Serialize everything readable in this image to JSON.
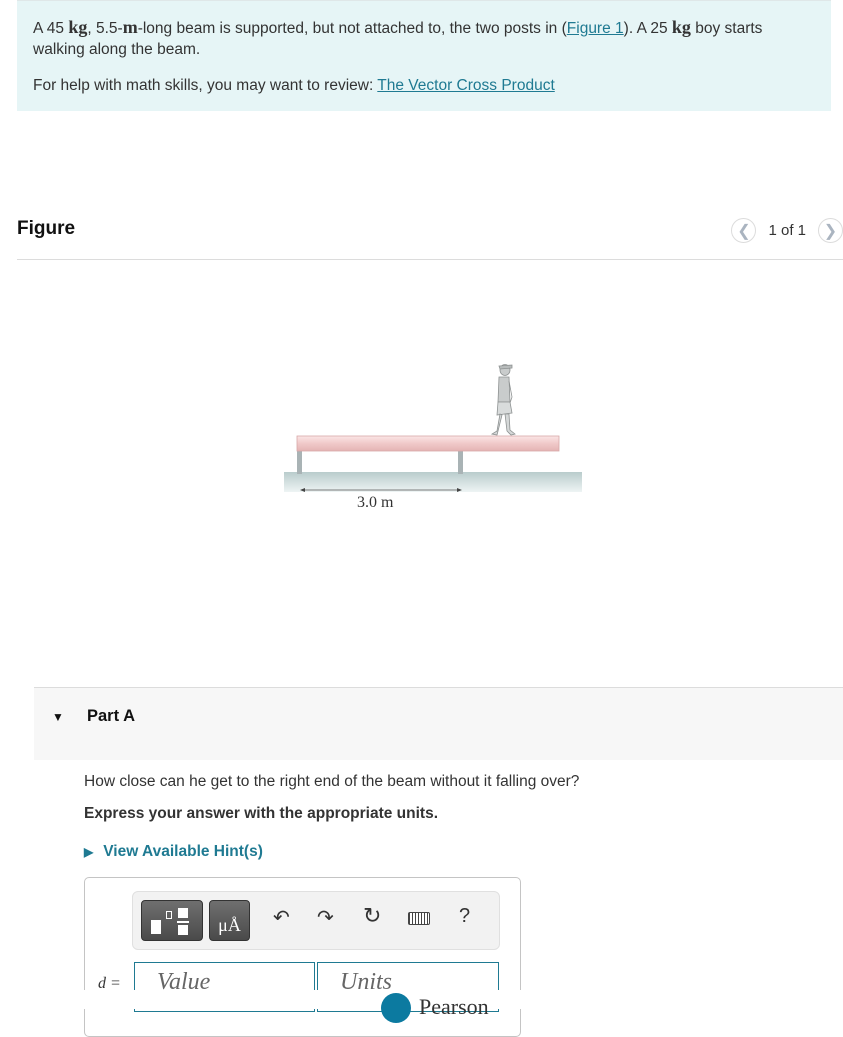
{
  "problem": {
    "text_pre1": "A 45 ",
    "unit_kg": "kg",
    "text_mid1": ", 5.5-",
    "unit_m": "m",
    "text_mid2": "-long beam is supported, but not attached to, the two posts in (",
    "figure_link": "Figure 1",
    "text_mid3": "). A 25 ",
    "unit_kg2": "kg",
    "text_post": " boy starts walking along the beam.",
    "help_text": "For help with math skills, you may want to review: ",
    "help_link": "The Vector Cross Product"
  },
  "figure": {
    "title": "Figure",
    "pager_text": "1 of 1",
    "prev_icon": "chevron-left-icon",
    "next_icon": "chevron-right-icon",
    "dimension_label": "3.0 m",
    "colors": {
      "beam": "#f3d2d2",
      "post": "#a9b3b5",
      "ground": "#dfe9e9"
    }
  },
  "part": {
    "title": "Part A",
    "question": "How close can he get to the right end of the beam without it falling over?",
    "instruction": "Express your answer with the appropriate units.",
    "hint_label": "View Available Hint(s)"
  },
  "answer": {
    "label": "d =",
    "value_placeholder": "Value",
    "units_placeholder": "Units",
    "toolbar": {
      "templates_icon": "templates-icon",
      "units_button": "μÅ",
      "undo_icon": "undo-icon",
      "redo_icon": "redo-icon",
      "reset_icon": "reset-icon",
      "keyboard_icon": "keyboard-icon",
      "help_label": "?"
    }
  },
  "footer": {
    "brand": "Pearson"
  },
  "colors": {
    "accent": "#1f7a92",
    "problem_bg": "#e6f5f6",
    "part_bg": "#f7f7f7"
  }
}
